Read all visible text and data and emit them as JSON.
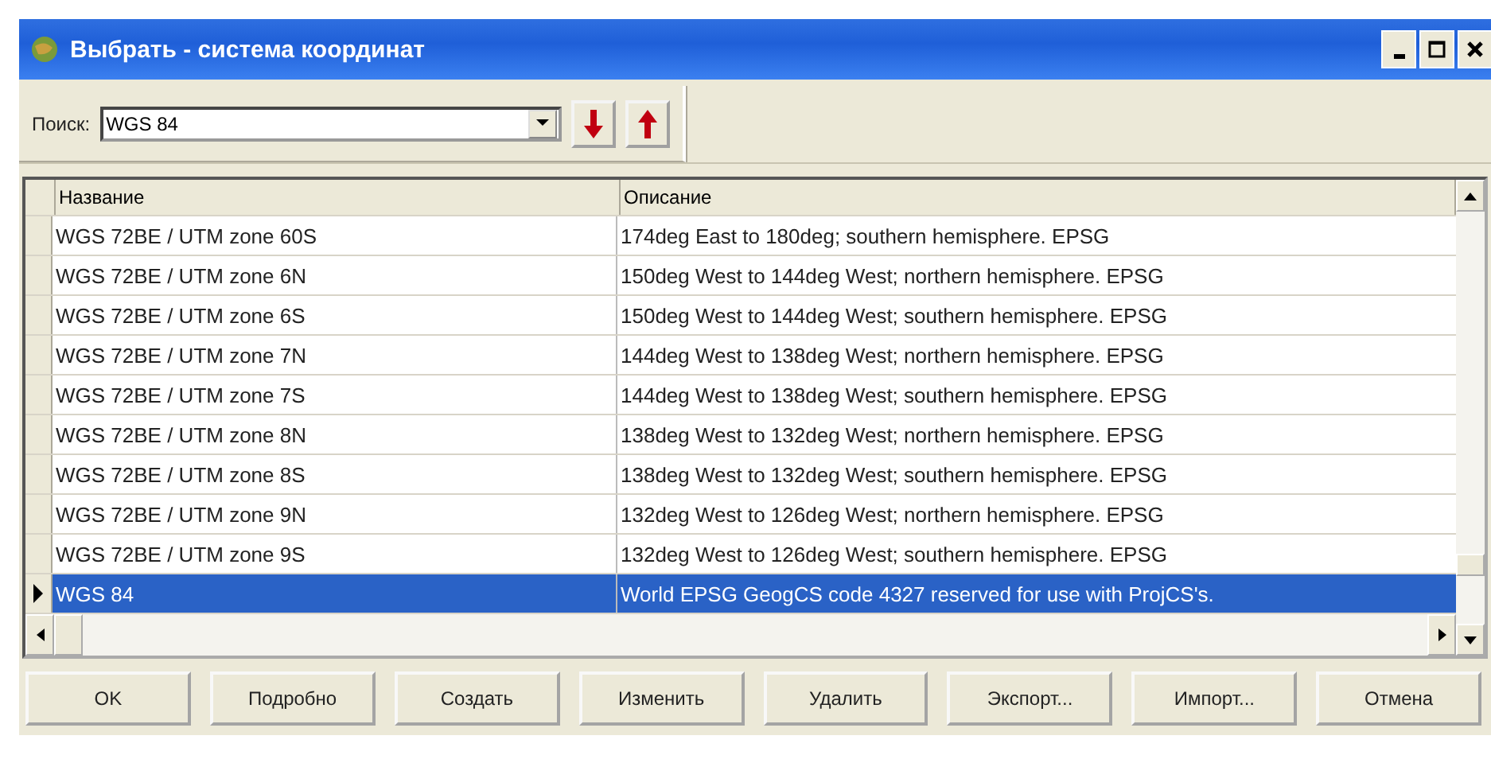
{
  "window": {
    "title": "Выбрать - система координат"
  },
  "search": {
    "label": "Поиск:",
    "value": "WGS 84"
  },
  "table": {
    "columns": [
      "Название",
      "Описание"
    ],
    "rows": [
      {
        "name": "WGS 72BE / UTM zone 60S",
        "description": "174deg East to 180deg; southern hemisphere. EPSG",
        "selected": false
      },
      {
        "name": "WGS 72BE / UTM zone 6N",
        "description": "150deg West to 144deg West; northern hemisphere. EPSG",
        "selected": false
      },
      {
        "name": "WGS 72BE / UTM zone 6S",
        "description": "150deg West to 144deg West; southern hemisphere. EPSG",
        "selected": false
      },
      {
        "name": "WGS 72BE / UTM zone 7N",
        "description": "144deg West to 138deg West; northern hemisphere. EPSG",
        "selected": false
      },
      {
        "name": "WGS 72BE / UTM zone 7S",
        "description": "144deg West to 138deg West; southern hemisphere. EPSG",
        "selected": false
      },
      {
        "name": "WGS 72BE / UTM zone 8N",
        "description": "138deg West to 132deg West; northern hemisphere. EPSG",
        "selected": false
      },
      {
        "name": "WGS 72BE / UTM zone 8S",
        "description": "138deg West to 132deg West; southern hemisphere. EPSG",
        "selected": false
      },
      {
        "name": "WGS 72BE / UTM zone 9N",
        "description": "132deg West to 126deg West; northern hemisphere. EPSG",
        "selected": false
      },
      {
        "name": "WGS 72BE / UTM zone 9S",
        "description": "132deg West to 126deg West; southern hemisphere. EPSG",
        "selected": false
      },
      {
        "name": "WGS 84",
        "description": "World EPSG GeogCS code 4327 reserved for use with  ProjCS's.",
        "selected": true
      }
    ]
  },
  "buttons": [
    "OK",
    "Подробно",
    "Создать",
    "Изменить",
    "Удалить",
    "Экспорт...",
    "Импорт...",
    "Отмена"
  ]
}
